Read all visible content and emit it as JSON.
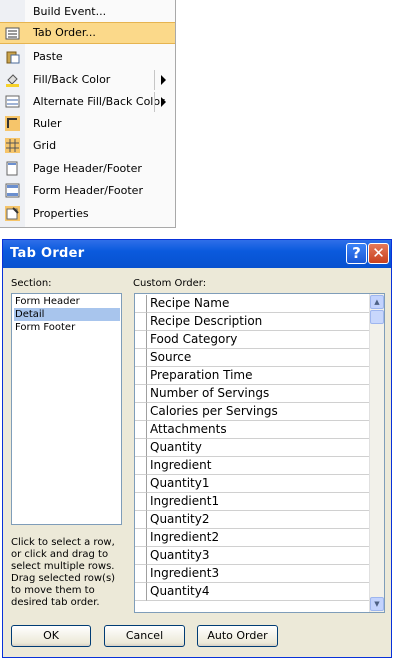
{
  "context_menu": {
    "items": [
      {
        "label": "Build Event..."
      },
      {
        "label": "Tab Order...",
        "highlighted": true
      },
      {
        "label": "Paste"
      },
      {
        "label": "Fill/Back Color",
        "submenu": true
      },
      {
        "label": "Alternate Fill/Back Color",
        "submenu": true
      },
      {
        "label": "Ruler"
      },
      {
        "label": "Grid"
      },
      {
        "label": "Page Header/Footer"
      },
      {
        "label": "Form Header/Footer"
      },
      {
        "label": "Properties"
      }
    ]
  },
  "dialog": {
    "title": "Tab Order",
    "section_label": "Section:",
    "sections": [
      "Form Header",
      "Detail",
      "Form Footer"
    ],
    "selected_section": "Detail",
    "custom_order_label": "Custom Order:",
    "fields": [
      "Recipe Name",
      "Recipe Description",
      "Food Category",
      "Source",
      "Preparation Time",
      "Number of Servings",
      "Calories per Servings",
      "Attachments",
      "Quantity",
      "Ingredient",
      "Quantity1",
      "Ingredient1",
      "Quantity2",
      "Ingredient2",
      "Quantity3",
      "Ingredient3",
      "Quantity4"
    ],
    "help_text": "Click to select a row, or click and drag to select multiple rows.  Drag selected row(s) to move them to desired tab order.",
    "buttons": {
      "ok": "OK",
      "cancel": "Cancel",
      "auto_order": "Auto Order"
    },
    "help_button_glyph": "?",
    "close_button_glyph": "✕"
  },
  "colors": {
    "title_bar": "#0a5add",
    "highlight": "#fbd98a",
    "selection": "#a8c5ed"
  }
}
